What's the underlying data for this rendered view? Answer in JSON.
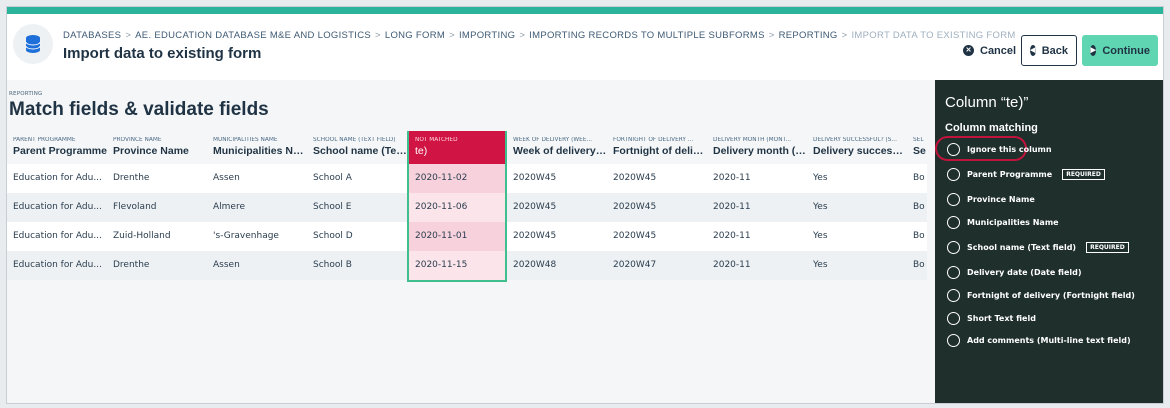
{
  "header": {
    "breadcrumb": [
      "DATABASES",
      "AE. EDUCATION DATABASE M&E AND LOGISTICS",
      "LONG FORM",
      "IMPORTING",
      "IMPORTING RECORDS TO MULTIPLE SUBFORMS",
      "REPORTING",
      "IMPORT DATA TO EXISTING FORM"
    ],
    "breadcrumb_sep": ">",
    "title": "Import data to existing form",
    "cancel_label": "Cancel",
    "back_label": "Back",
    "continue_label": "Continue"
  },
  "main": {
    "section_tag": "REPORTING",
    "section_title": "Match fields & validate fields",
    "columns": [
      {
        "sub": "PARENT PROGRAMME",
        "label": "Parent Programme"
      },
      {
        "sub": "PROVINCE NAME",
        "label": "Province Name"
      },
      {
        "sub": "MUNICIPALITIES NAME",
        "label": "Municipalities Name"
      },
      {
        "sub": "SCHOOL NAME (TEXT FIELD)",
        "label": "School name (Text ..."
      },
      {
        "sub": "NOT MATCHED",
        "label": "te)"
      },
      {
        "sub": "WEEK OF DELIVERY (WEE...",
        "label": "Week of delivery (..."
      },
      {
        "sub": "FORTNIGHT OF DELIVERY ...",
        "label": "Fortnight of deliver..."
      },
      {
        "sub": "DELIVERY MONTH (MONT...",
        "label": "Delivery month (M..."
      },
      {
        "sub": "DELIVERY SUCCESSFUL? (S...",
        "label": "Delivery successful..."
      },
      {
        "sub": "SEL",
        "label": "Se"
      }
    ],
    "rows": [
      [
        "Education for Adu...",
        "Drenthe",
        "Assen",
        "School A",
        "2020-11-02",
        "2020W45",
        "2020W45",
        "2020-11",
        "Yes",
        "Bo"
      ],
      [
        "Education for Adu...",
        "Flevoland",
        "Almere",
        "School E",
        "2020-11-06",
        "2020W45",
        "2020W45",
        "2020-11",
        "Yes",
        "Bo"
      ],
      [
        "Education for Adu...",
        "Zuid-Holland",
        "'s-Gravenhage",
        "School D",
        "2020-11-01",
        "2020W45",
        "2020W45",
        "2020-11",
        "Yes",
        "Bo"
      ],
      [
        "Education for Adu...",
        "Drenthe",
        "Assen",
        "School B",
        "2020-11-15",
        "2020W48",
        "2020W47",
        "2020-11",
        "Yes",
        "Bo"
      ]
    ]
  },
  "side": {
    "title": "Column “te)”",
    "subtitle": "Column matching",
    "required_label": "REQUIRED",
    "options": [
      {
        "label": "Ignore this column"
      },
      {
        "label": "Parent Programme"
      },
      {
        "label": "Province Name"
      },
      {
        "label": "Municipalities Name"
      },
      {
        "label": "School name (Text field)"
      },
      {
        "label": "Delivery date (Date field)"
      },
      {
        "label": "Fortnight of delivery (Fortnight field)"
      },
      {
        "label": "Short Text field"
      },
      {
        "label": "Add comments (Multi-line text field)"
      }
    ]
  },
  "colors": {
    "accent": "#2cb39c",
    "continue": "#5fd5b1",
    "not_matched": "#d01444",
    "sidebar": "#1f2f2c"
  }
}
